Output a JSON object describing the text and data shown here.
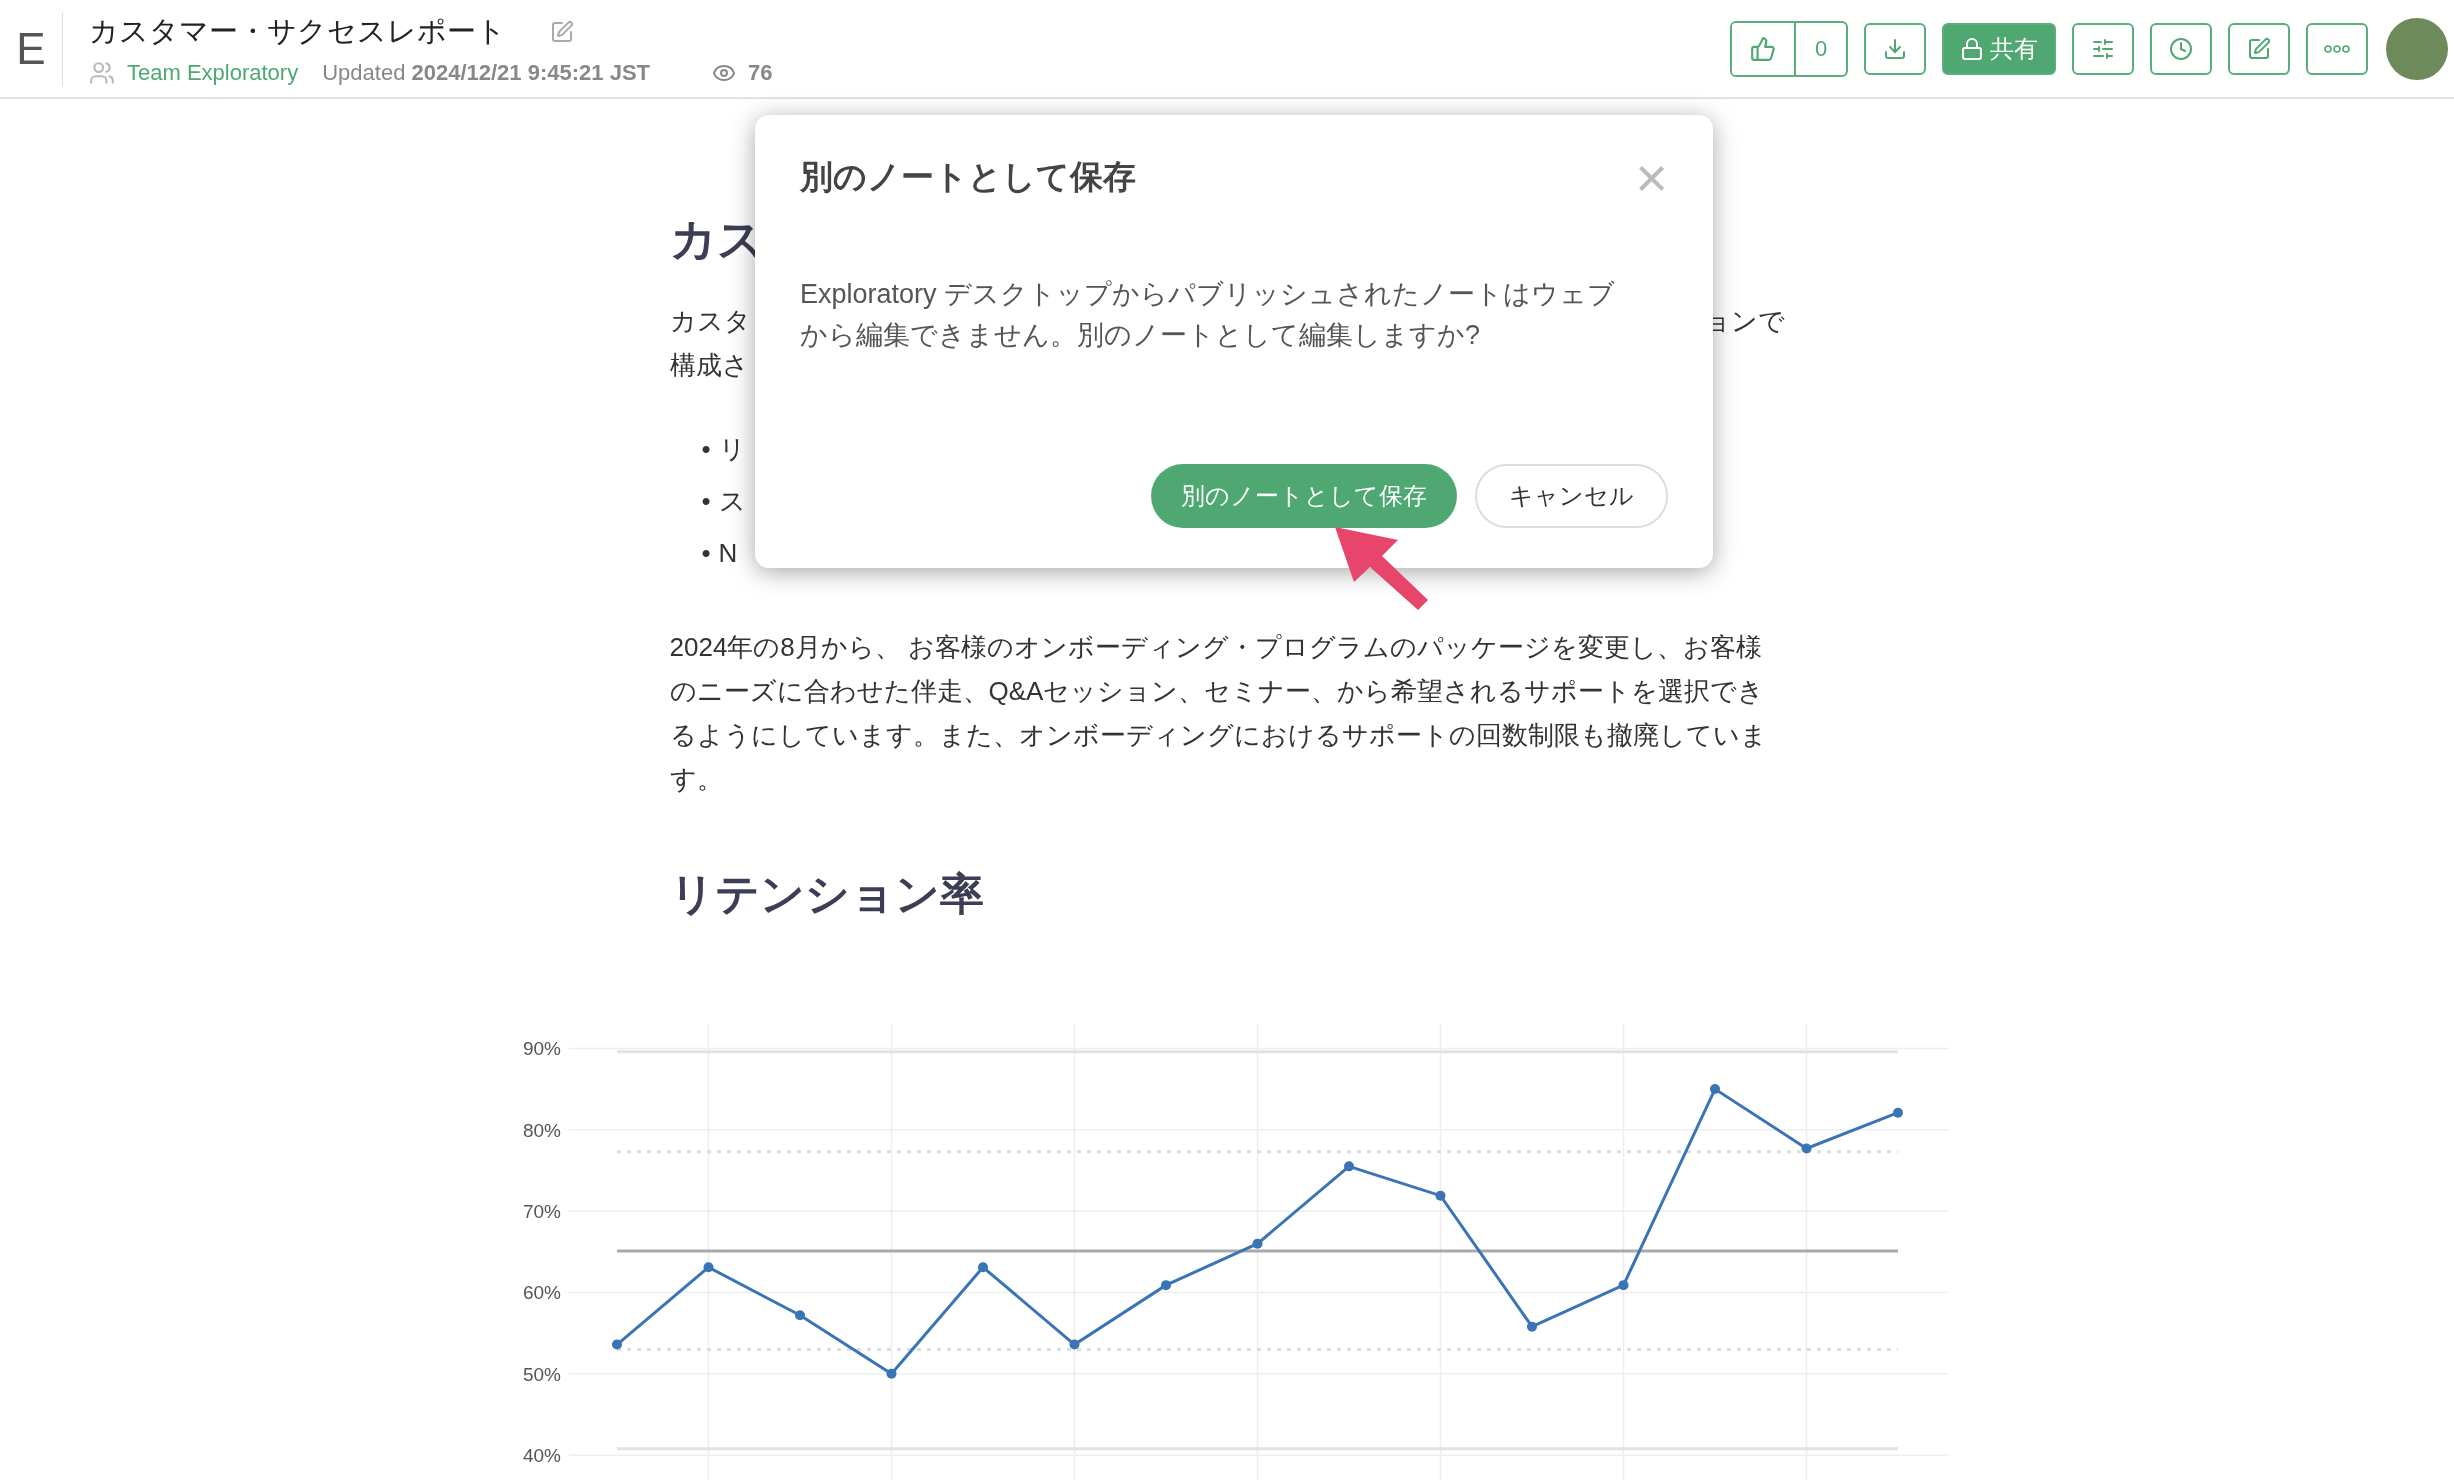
{
  "header": {
    "logo": "E",
    "title": "カスタマー・サクセスレポート",
    "team": "Team Exploratory",
    "updated": "Updated **2024/12/21 9:45:21 JST**",
    "views": "76"
  },
  "toolbar": [
    {
      "kind": "like",
      "count": "0"
    },
    {
      "kind": "download"
    },
    {
      "kind": "share",
      "label": "共有"
    },
    {
      "kind": "settings"
    },
    {
      "kind": "history"
    },
    {
      "kind": "edit"
    },
    {
      "kind": "more"
    }
  ],
  "document": {
    "heading": "カス",
    "intro_left": "カスタ",
    "intro_right": "ョンで",
    "intro_line2": "構成さ",
    "bullets": [
      {
        "marker": "•",
        "text": "リ"
      },
      {
        "marker": "•",
        "text": "ス"
      },
      {
        "marker": "•",
        "text": "N"
      }
    ],
    "paragraph": "2024年の8月から、 お客様のオンボーディング・プログラムのパッケージを変更し、お客様のニーズに合わせた伴走、Q&Aセッション、セミナー、から希望されるサポートを選択できるようにしています。また、オンボーディングにおけるサポートの回数制限も撤廃しています。",
    "section_heading": "リテンション率",
    "chart_data": {
      "type": "line",
      "grid": true,
      "ylim": [
        34,
        93
      ],
      "yticks": [
        {
          "value": 40,
          "label": "40%"
        },
        {
          "value": 50,
          "label": "50%"
        },
        {
          "value": 60,
          "label": "60%"
        },
        {
          "value": 70,
          "label": "70%"
        },
        {
          "value": 80,
          "label": "80%"
        },
        {
          "value": 90,
          "label": "90%"
        }
      ],
      "series": [
        {
          "color": "#3b74b4",
          "marker": true,
          "values": [
            53.6,
            63.1,
            57.2,
            50.0,
            63.1,
            53.6,
            60.9,
            66.0,
            75.5,
            71.9,
            55.8,
            60.9,
            85.0,
            77.7,
            82.1
          ]
        },
        {
          "color": "#aaaaaa",
          "marker": false,
          "values": [
            65.1,
            65.1,
            65.1,
            65.1,
            65.1,
            65.1,
            65.1,
            65.1,
            65.1,
            65.1,
            65.1,
            65.1,
            65.1,
            65.1,
            65.1
          ]
        },
        {
          "color": "#dddddd",
          "marker": false,
          "line_style": "dashed",
          "values": [
            77.3,
            77.3,
            77.3,
            77.3,
            77.3,
            77.3,
            77.3,
            77.3,
            77.3,
            77.3,
            77.3,
            77.3,
            77.3,
            77.3,
            77.3
          ]
        },
        {
          "color": "#dddddd",
          "marker": false,
          "line_style": "dashed",
          "values": [
            53.0,
            53.0,
            53.0,
            53.0,
            53.0,
            53.0,
            53.0,
            53.0,
            53.0,
            53.0,
            53.0,
            53.0,
            53.0,
            53.0,
            53.0
          ]
        },
        {
          "color": "#e2e2e2",
          "marker": false,
          "values": [
            89.6,
            89.6,
            89.6,
            89.6,
            89.6,
            89.6,
            89.6,
            89.6,
            89.6,
            89.6,
            89.6,
            89.6,
            89.6,
            89.6,
            89.6
          ]
        },
        {
          "color": "#e2e2e2",
          "marker": false,
          "values": [
            40.8,
            40.8,
            40.8,
            40.8,
            40.8,
            40.8,
            40.8,
            40.8,
            40.8,
            40.8,
            40.8,
            40.8,
            40.8,
            40.8,
            40.8
          ]
        }
      ]
    }
  },
  "dialog": {
    "title": "別のノートとして保存",
    "message": "Exploratory デスクトップからパブリッシュされたノートはウェブから編集できません。別のノートとして編集しますか?",
    "primary": "別のノートとして保存",
    "cancel": "キャンセル",
    "close": "×"
  }
}
